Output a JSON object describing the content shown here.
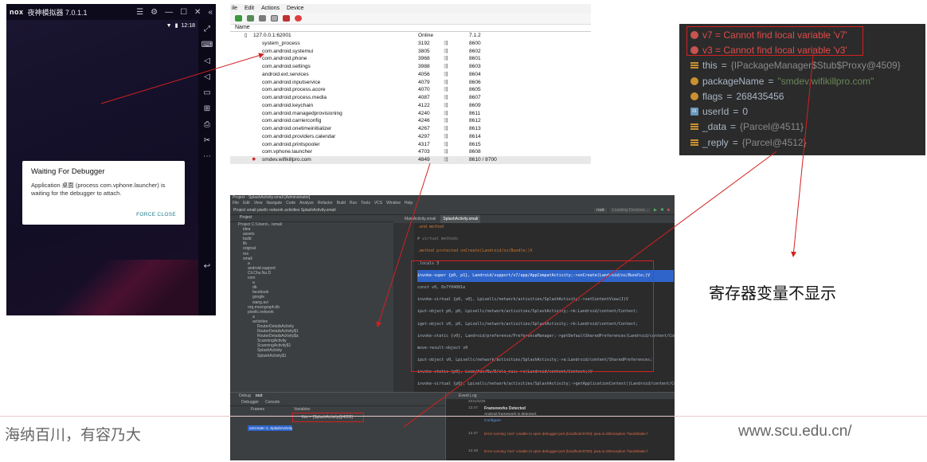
{
  "emulator": {
    "title": "夜神模拟器 7.0.1.1",
    "logo": "nox",
    "status_time": "12:18",
    "dialog": {
      "title": "Waiting For Debugger",
      "body": "Application 桌面 (process com.vphone.launcher) is waiting for the debugger to attach.",
      "button": "FORCE CLOSE"
    }
  },
  "ddms": {
    "menu": [
      "ile",
      "Edit",
      "Actions",
      "Device"
    ],
    "column_header": "Name",
    "device": {
      "name": "127.0.0.1:62001",
      "state": "Online",
      "version": "7.1.2"
    },
    "processes": [
      {
        "name": "system_process",
        "pid": "3192",
        "port": "8600"
      },
      {
        "name": "com.android.systemui",
        "pid": "3805",
        "port": "8602"
      },
      {
        "name": "com.android.phone",
        "pid": "3968",
        "port": "8601"
      },
      {
        "name": "com.android.settings",
        "pid": "3988",
        "port": "8603"
      },
      {
        "name": "android.ext.services",
        "pid": "4056",
        "port": "8604"
      },
      {
        "name": "com.android.inputservice",
        "pid": "4079",
        "port": "8606"
      },
      {
        "name": "com.android.process.acore",
        "pid": "4070",
        "port": "8605"
      },
      {
        "name": "com.android.process.media",
        "pid": "4087",
        "port": "8607"
      },
      {
        "name": "com.android.keychain",
        "pid": "4122",
        "port": "8609"
      },
      {
        "name": "com.android.managedprovisioning",
        "pid": "4240",
        "port": "8611"
      },
      {
        "name": "com.android.carrierconfig",
        "pid": "4246",
        "port": "8612"
      },
      {
        "name": "com.android.onetimeinitializer",
        "pid": "4267",
        "port": "8613"
      },
      {
        "name": "com.android.providers.calendar",
        "pid": "4297",
        "port": "8614"
      },
      {
        "name": "com.android.printspooler",
        "pid": "4317",
        "port": "8615"
      },
      {
        "name": "com.vphone.launcher",
        "pid": "4703",
        "port": "8608"
      },
      {
        "name": "smdev.wifikillpro.com",
        "pid": "4849",
        "port": "8610 / 8700"
      }
    ]
  },
  "studio": {
    "title": "Project - SplashActivity.smali [Administrator]",
    "menu": [
      "File",
      "Edit",
      "View",
      "Navigate",
      "Code",
      "Analyze",
      "Refactor",
      "Build",
      "Run",
      "Tools",
      "VCS",
      "Window",
      "Help"
    ],
    "breadcrumb": "Project  smali  pixellc  network  activities  SplashActivity.smali",
    "tabs": [
      "MainActivity.smali",
      "SplashActivity.smali"
    ],
    "run_config": "root",
    "device_field": "Loading Devices...",
    "project_label": "Project",
    "tree": [
      "Project  C:\\Users\\...\\smali",
      "idea",
      "assets",
      "build",
      "lib",
      "original",
      "res",
      "smali",
      "a",
      "android.support",
      "Cli.Chu.Nu.D",
      "com",
      "a",
      "db",
      "facebook",
      "google",
      "wang.avi",
      "org.mozograph.lib",
      "pixellc.network",
      "a",
      "activities",
      "RouterDetailsActivity",
      "RouterDetailsActivity$1",
      "RouterDetailsActivity$a",
      "ScanningActivity",
      "ScanningActivity$1",
      "SplashActivity",
      "SplashActivity$1"
    ],
    "code": [
      ".end method",
      "# virtual methods",
      ".method protected onCreate(Landroid/os/Bundle;)V",
      "    .locals 3",
      "invoke-super {p0, p1}, Landroid/support/v7/app/AppCompatActivity;->onCreate(Landroid/os/Bundle;)V",
      "const v0, 0x7f04001e",
      "invoke-virtual {p0, v0}, Lpixellc/network/activities/SplashActivity;->setContentView(I)V",
      "iput-object p0, p0, Lpixellc/network/activities/SplashActivity;->b:Landroid/content/Context;",
      "iget-object v0, p0, Lpixellc/network/activities/SplashActivity;->b:Landroid/content/Context;",
      "invoke-static {v0}, Landroid/preference/PreferenceManager;->getDefaultSharedPreferences(Landroid/content/Context;)",
      "move-result-object v0",
      "iput-object v0, Lpixellc/network/activities/SplashActivity;->a:Landroid/content/SharedPreferences;",
      "invoke-static {p0}, Lcom/fax/Nu/D/cla_nux;->c(Landroid/content/Context;)V",
      "invoke-virtual {p0}, Lpixellc/network/activities/SplashActivity;->getApplicationContext()Landroid/content/Cont"
    ],
    "debug": {
      "tabs": [
        "Debug",
        "root"
      ],
      "subtabs": [
        "Debugger",
        "Console"
      ],
      "frames_label": "Frames",
      "variables_label": "Variables",
      "frame_selected": "onCreate:-1, SplashActivity",
      "variable": "this = {SplashActivity@4352}",
      "event_log": {
        "title": "Event Log",
        "date": "2021/5/28",
        "entries": [
          {
            "time": "12:47",
            "title": "Frameworks Detected",
            "text": "Android framework is detected.",
            "link": "Configure"
          },
          {
            "time": "12:47",
            "text": "Error running 'root': Unable to open debugger port (localhost:8700): java.io.IOException \"handshake f"
          },
          {
            "time": "12:48",
            "text": "Error running 'root': Unable to open debugger port (localhost:8700): java.io.IOException \"handshake f"
          }
        ]
      }
    }
  },
  "variables_panel": {
    "rows": [
      {
        "icon": "error-icon",
        "text": "v7 = Cannot find local variable 'v7'"
      },
      {
        "icon": "error-icon",
        "text": "v3 = Cannot find local variable 'v3'"
      },
      {
        "icon": "field-icon",
        "name": "this",
        "value": "{IPackageManager$Stub$Proxy@4509}"
      },
      {
        "icon": "param-icon",
        "name": "packageName",
        "value": "\"smdev.wifikillpro.com\""
      },
      {
        "icon": "param-icon",
        "name": "flags",
        "value": "268435456"
      },
      {
        "icon": "int-icon",
        "name": "userId",
        "value": "0"
      },
      {
        "icon": "field-icon",
        "name": "_data",
        "value": "{Parcel@4511}"
      },
      {
        "icon": "field-icon",
        "name": "_reply",
        "value": "{Parcel@4512}"
      }
    ]
  },
  "caption": "寄存器变量不显示",
  "footer": {
    "left": "海纳百川，有容乃大",
    "right": "www.scu.edu.cn/"
  },
  "colors": {
    "annotation": "#d32020",
    "ide_bg": "#2b2b2b",
    "error": "#e04b4b"
  }
}
